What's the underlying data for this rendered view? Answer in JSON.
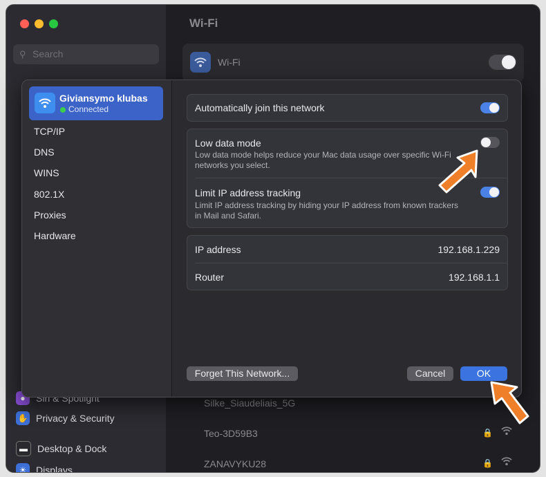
{
  "settings": {
    "search_placeholder": "Search",
    "sidebar_items": [
      {
        "label": "Siri & Spotlight",
        "icon": "siri-icon",
        "color": "#8a4fd8"
      },
      {
        "label": "Privacy & Security",
        "icon": "hand-icon",
        "color": "#3d6fd6"
      },
      {
        "label": "Desktop & Dock",
        "icon": "dock-icon",
        "color": "#2a2a2e"
      },
      {
        "label": "Displays",
        "icon": "display-icon",
        "color": "#3d6fd6"
      }
    ],
    "page_title": "Wi-Fi",
    "wifi_label": "Wi-Fi",
    "networks": [
      "Silke_Siaudeliais_5G",
      "Teo-3D59B3",
      "ZANAVYKU28"
    ]
  },
  "dialog": {
    "network_name": "Giviansymo klubas",
    "network_status": "Connected",
    "side_items": [
      "TCP/IP",
      "DNS",
      "WINS",
      "802.1X",
      "Proxies",
      "Hardware"
    ],
    "auto_join_label": "Automatically join this network",
    "low_data_label": "Low data mode",
    "low_data_desc": "Low data mode helps reduce your Mac data usage over specific Wi-Fi networks you select.",
    "limit_ip_label": "Limit IP address tracking",
    "limit_ip_desc": "Limit IP address tracking by hiding your IP address from known trackers in Mail and Safari.",
    "ip_label": "IP address",
    "ip_value": "192.168.1.229",
    "router_label": "Router",
    "router_value": "192.168.1.1",
    "forget_label": "Forget This Network...",
    "cancel_label": "Cancel",
    "ok_label": "OK",
    "toggles": {
      "auto_join": true,
      "low_data": false,
      "limit_ip": true
    }
  },
  "colors": {
    "accent": "#3b73e0",
    "annotation_arrow": "#f07f2a"
  }
}
